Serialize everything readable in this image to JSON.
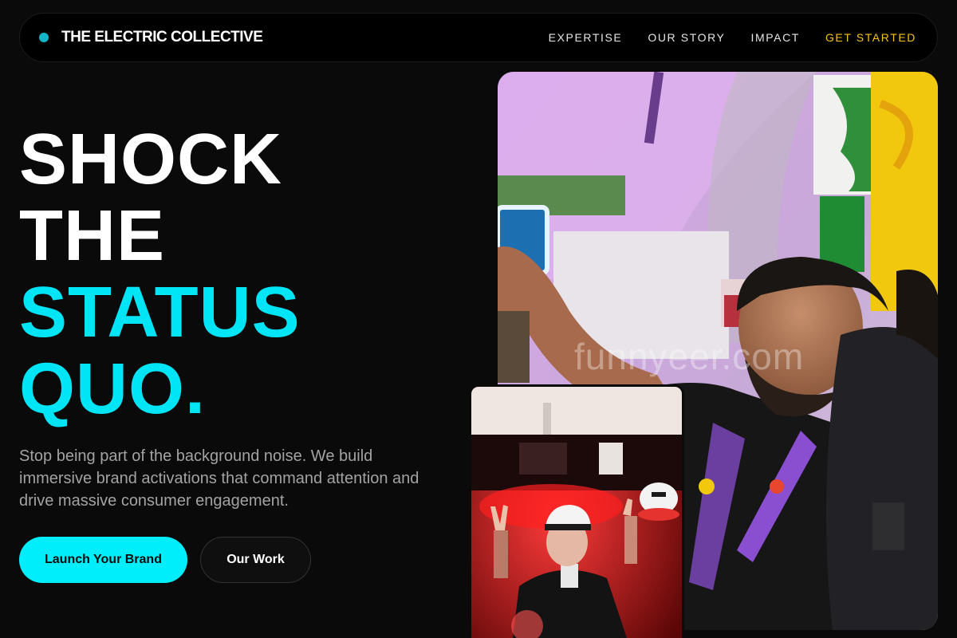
{
  "nav": {
    "brand": "THE ELECTRIC COLLECTIVE",
    "links": [
      "EXPERTISE",
      "OUR STORY",
      "IMPACT"
    ],
    "cta": "GET STARTED"
  },
  "hero": {
    "line1": "SHOCK",
    "line2": "THE",
    "line3": "STATUS",
    "line4": "QUO.",
    "subtext": "Stop being part of the background noise. We build immersive brand activations that command attention and drive massive consumer engagement.",
    "primary_button": "Launch Your Brand",
    "secondary_button": "Our Work"
  },
  "photos": {
    "watermark": "funnyeer.com"
  },
  "colors": {
    "accent": "#00e5f5",
    "cta": "#f5c518",
    "background": "#0a0a0a"
  }
}
